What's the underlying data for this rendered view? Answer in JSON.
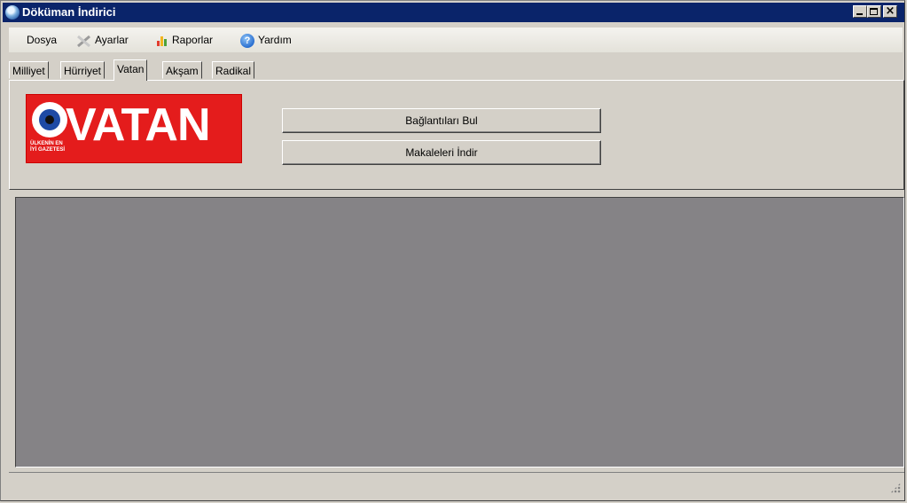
{
  "window": {
    "title": "Döküman İndirici",
    "title_bar_color": "#0a246a"
  },
  "menubar": {
    "items": [
      {
        "label": "Dosya",
        "icon": ""
      },
      {
        "label": "Ayarlar",
        "icon": "tools-icon"
      },
      {
        "label": "Raporlar",
        "icon": "chart-icon"
      },
      {
        "label": "Yardım",
        "icon": "help-icon"
      }
    ]
  },
  "tabs": [
    {
      "label": "Milliyet",
      "active": false
    },
    {
      "label": "Hürriyet",
      "active": false
    },
    {
      "label": "Vatan",
      "active": true
    },
    {
      "label": "Akşam",
      "active": false
    },
    {
      "label": "Radikal",
      "active": false
    }
  ],
  "panel": {
    "logo": {
      "word": "VATAN",
      "tagline": "ÜLKENİN EN İYİ GAZETESİ",
      "color": "#e41c1c"
    },
    "find_links_button": "Bağlantıları Bul",
    "download_articles_button": "Makaleleri İndir"
  },
  "content": {
    "background": "#858386"
  }
}
